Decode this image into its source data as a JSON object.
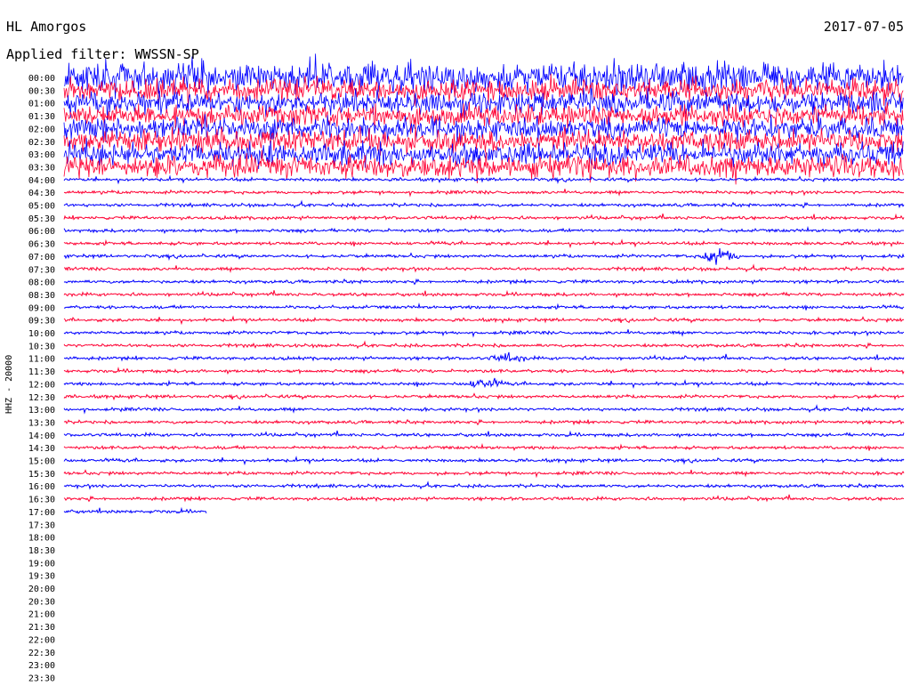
{
  "header": {
    "station": "HL Amorgos",
    "date": "2017-07-05",
    "filter_label": "Applied filter: WWSSN-SP"
  },
  "chart_data": {
    "type": "line",
    "title": "HL Amorgos",
    "ylabel": "HHZ - 20000",
    "row_labels": [
      "00:00",
      "00:30",
      "01:00",
      "01:30",
      "02:00",
      "02:30",
      "03:00",
      "03:30",
      "04:00",
      "04:30",
      "05:00",
      "05:30",
      "06:00",
      "06:30",
      "07:00",
      "07:30",
      "08:00",
      "08:30",
      "09:00",
      "09:30",
      "10:00",
      "10:30",
      "11:00",
      "11:30",
      "12:00",
      "12:30",
      "13:00",
      "13:30",
      "14:00",
      "14:30",
      "15:00",
      "15:30",
      "16:00",
      "16:30",
      "17:00",
      "17:30",
      "18:00",
      "18:30",
      "19:00",
      "19:30",
      "20:00",
      "20:30",
      "21:00",
      "21:30",
      "22:00",
      "22:30",
      "23:00",
      "23:30"
    ],
    "row_minutes": 30,
    "series_colors": [
      "#0000ff",
      "#ff0033"
    ],
    "last_row_fraction": 0.17,
    "high_noise_until": "04:00",
    "events": [
      {
        "row": "07:00",
        "position": 0.78,
        "amplitude": 3.0
      },
      {
        "row": "12:00",
        "position": 0.5,
        "amplitude": 1.6
      },
      {
        "row": "11:00",
        "position": 0.53,
        "amplitude": 1.3
      }
    ],
    "grid": false
  }
}
